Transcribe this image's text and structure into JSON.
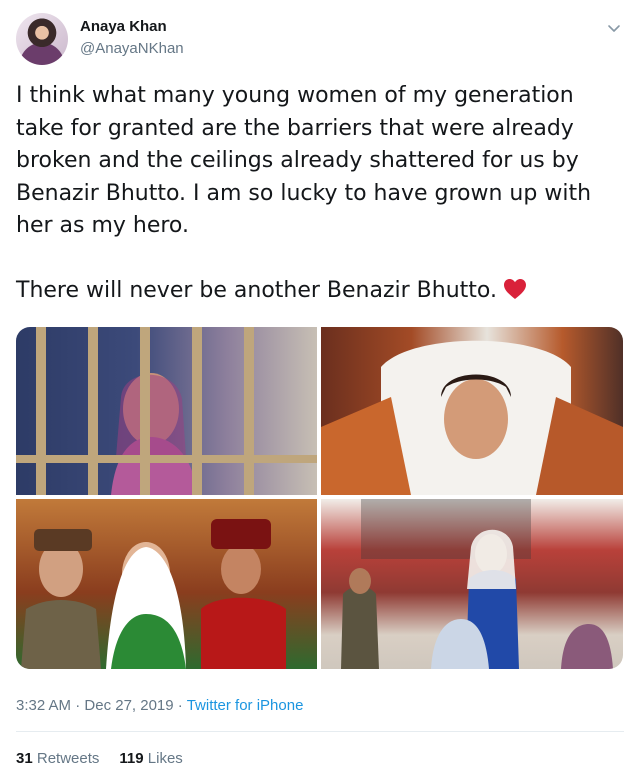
{
  "author": {
    "display_name": "Anaya Khan",
    "handle": "@AnayaNKhan"
  },
  "tweet": {
    "paragraph1": "I think what many young women of my generation take for granted are the barriers that were already broken and the ceilings already shattered for us by Benazir Bhutto. I am so lucky to have grown up with her as my hero.",
    "paragraph2": "There will never be another Benazir Bhutto.",
    "emoji_icon": "red-heart-icon"
  },
  "media": {
    "photo_count": 4
  },
  "meta": {
    "time": "3:32 AM",
    "separator": "·",
    "date": "Dec 27, 2019",
    "separator2": "·",
    "source": "Twitter for iPhone"
  },
  "stats": {
    "retweets_count": "31",
    "retweets_label": "Retweets",
    "likes_count": "119",
    "likes_label": "Likes"
  },
  "colors": {
    "link": "#1b95e0",
    "secondary_text": "#657786",
    "heart": "#e0245e"
  }
}
